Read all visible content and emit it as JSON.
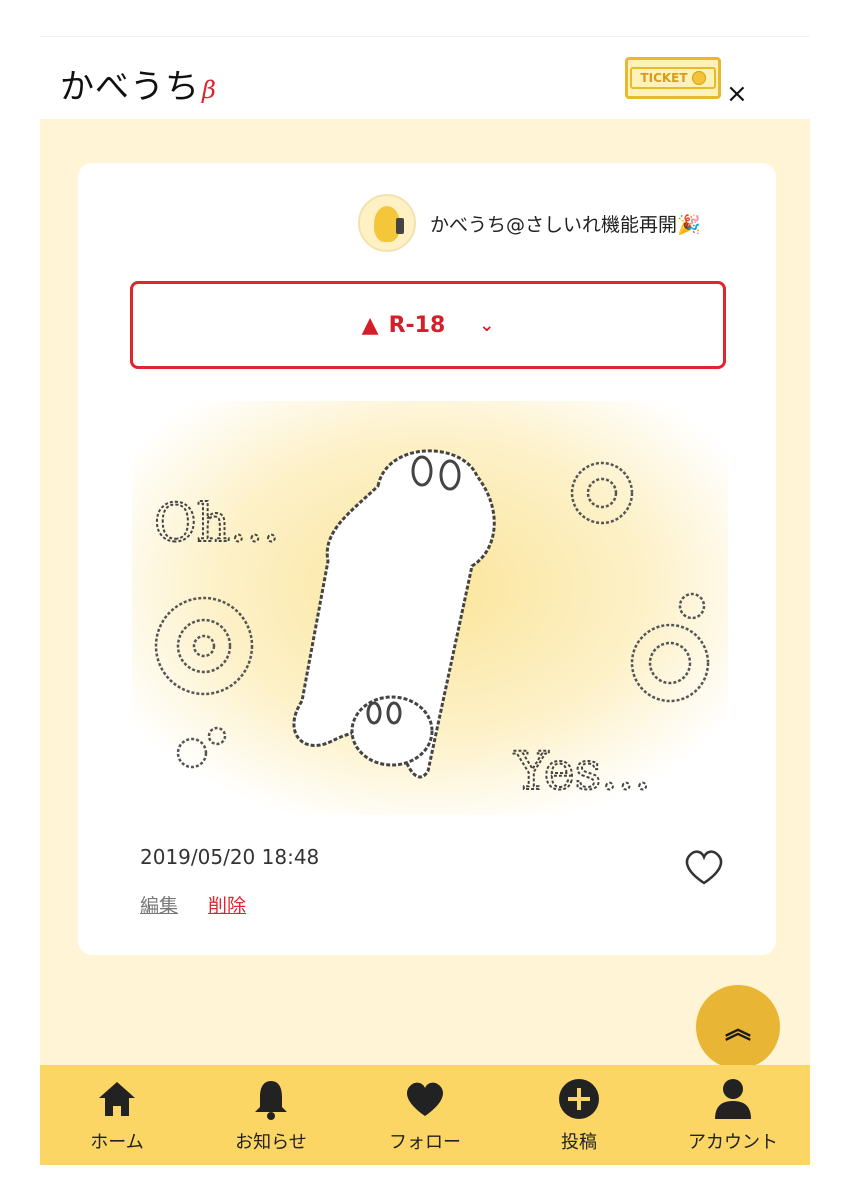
{
  "header": {
    "logo": "かべうち",
    "logo_suffix": "β",
    "ticket_label": "TICKET",
    "close_symbol": "×"
  },
  "post": {
    "author_name": "かべうち@さしいれ機能再開🎉",
    "rating_label": "R-18",
    "illustration_text": {
      "left": "Oh...",
      "right": "Yes..."
    },
    "timestamp": "2019/05/20 18:48",
    "edit_label": "編集",
    "delete_label": "削除"
  },
  "nav": {
    "items": [
      {
        "label": "ホーム",
        "icon": "home-icon"
      },
      {
        "label": "お知らせ",
        "icon": "bell-icon"
      },
      {
        "label": "フォロー",
        "icon": "heart-icon"
      },
      {
        "label": "投稿",
        "icon": "plus-circle-icon"
      },
      {
        "label": "アカウント",
        "icon": "person-icon"
      }
    ]
  },
  "colors": {
    "accent_yellow": "#fbd664",
    "background_cream": "#fff5d6",
    "warning_red": "#e1252f"
  }
}
